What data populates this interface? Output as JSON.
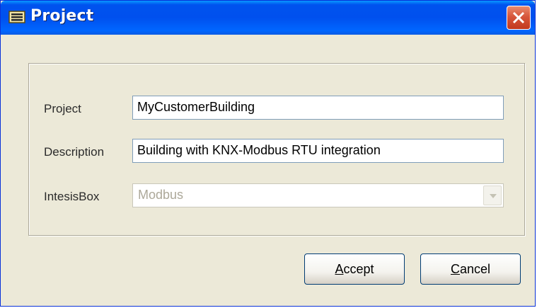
{
  "window": {
    "title": "Project",
    "close_symbol": "×"
  },
  "form": {
    "project_label": "Project",
    "project_value": "MyCustomerBuilding",
    "description_label": "Description",
    "description_value": "Building with KNX-Modbus RTU integration",
    "intesisbox_label": "IntesisBox",
    "intesisbox_selected": "Modbus"
  },
  "buttons": {
    "accept_mnemonic": "A",
    "accept_rest": "ccept",
    "cancel_mnemonic": "C",
    "cancel_rest": "ancel"
  },
  "colors": {
    "titlebar": "#0053ee",
    "window_bg": "#ece9d8",
    "close_button": "#d7563b"
  },
  "icons": {
    "title": "window-app-icon",
    "close": "close-icon",
    "dropdown": "chevron-down-icon"
  }
}
